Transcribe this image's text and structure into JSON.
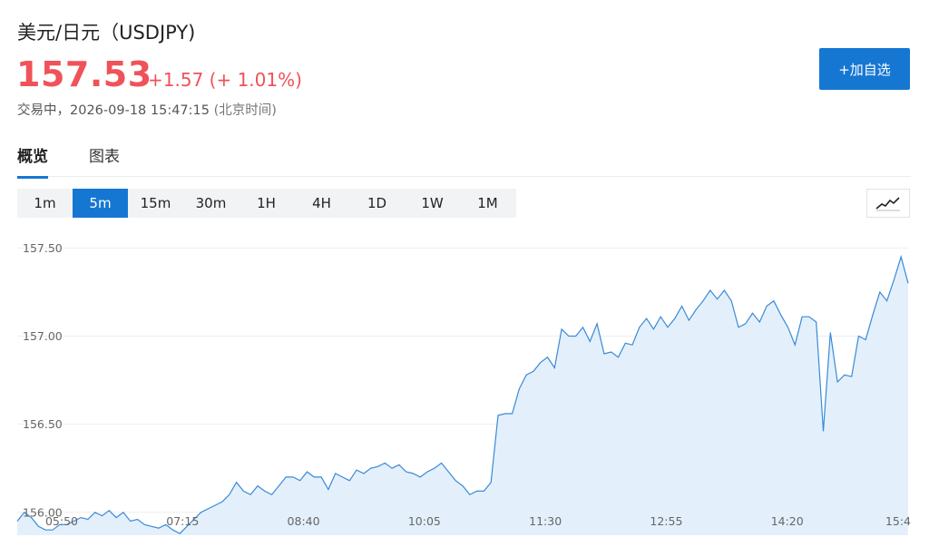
{
  "header": {
    "title": "美元/日元（USDJPY)",
    "price": "157.53",
    "change": "+1.57 (+ 1.01%)",
    "status": "交易中，2026-09-18 15:47:15",
    "timezone": "(北京时间)",
    "add_button": "+加自选"
  },
  "tabs": [
    "概览",
    "图表"
  ],
  "intervals": [
    "1m",
    "5m",
    "15m",
    "30m",
    "1H",
    "4H",
    "1D",
    "1W",
    "1M"
  ],
  "active_interval": "5m",
  "colors": {
    "up": "#f0525a",
    "accent": "#1677d2",
    "line": "#3a8ad6",
    "fill": "#e3f0fc"
  },
  "chart_data": {
    "type": "area",
    "y_ticks": [
      "157.50",
      "157.00",
      "156.50",
      "156.00"
    ],
    "x_ticks": [
      "05:50",
      "07:15",
      "08:40",
      "10:05",
      "11:30",
      "12:55",
      "14:20",
      "15:4"
    ],
    "ylim": [
      155.87,
      157.6
    ],
    "grid": true,
    "values": [
      155.95,
      156.0,
      155.97,
      155.92,
      155.9,
      155.9,
      155.93,
      155.93,
      155.95,
      155.97,
      155.96,
      156.0,
      155.98,
      156.01,
      155.97,
      156.0,
      155.95,
      155.96,
      155.93,
      155.92,
      155.91,
      155.93,
      155.9,
      155.88,
      155.92,
      155.96,
      156.0,
      156.02,
      156.04,
      156.06,
      156.1,
      156.17,
      156.12,
      156.1,
      156.15,
      156.12,
      156.1,
      156.15,
      156.2,
      156.2,
      156.18,
      156.23,
      156.2,
      156.2,
      156.13,
      156.22,
      156.2,
      156.18,
      156.24,
      156.22,
      156.25,
      156.26,
      156.28,
      156.25,
      156.27,
      156.23,
      156.22,
      156.2,
      156.23,
      156.25,
      156.28,
      156.23,
      156.18,
      156.15,
      156.1,
      156.12,
      156.12,
      156.17,
      156.55,
      156.56,
      156.56,
      156.7,
      156.78,
      156.8,
      156.85,
      156.88,
      156.82,
      157.04,
      157.0,
      157.0,
      157.05,
      156.97,
      157.07,
      156.9,
      156.91,
      156.88,
      156.96,
      156.95,
      157.05,
      157.1,
      157.04,
      157.11,
      157.05,
      157.1,
      157.17,
      157.09,
      157.15,
      157.2,
      157.26,
      157.21,
      157.26,
      157.2,
      157.05,
      157.07,
      157.13,
      157.08,
      157.17,
      157.2,
      157.12,
      157.05,
      156.95,
      157.11,
      157.11,
      157.08,
      156.46,
      157.02,
      156.74,
      156.78,
      156.77,
      157.0,
      156.98,
      157.12,
      157.25,
      157.2,
      157.32,
      157.45,
      157.3
    ]
  }
}
